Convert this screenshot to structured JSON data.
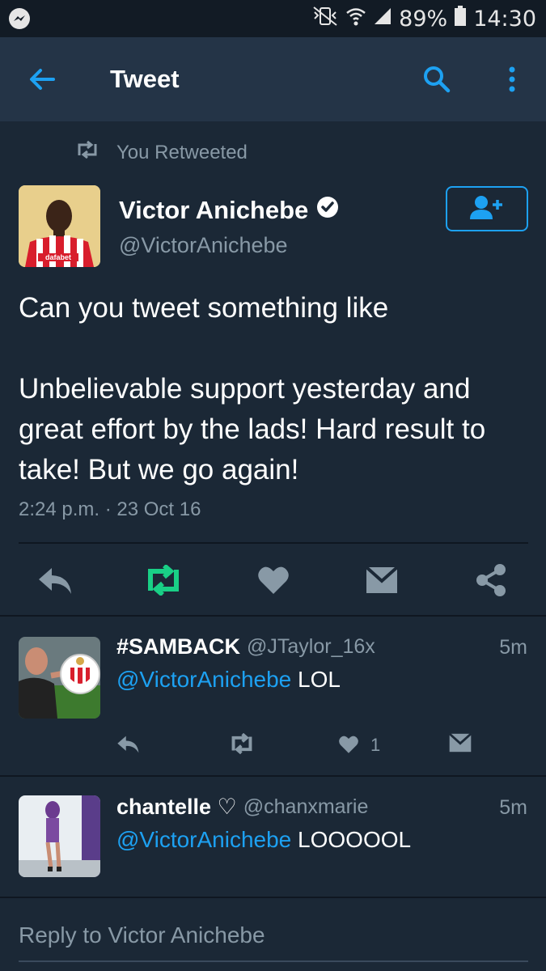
{
  "status_bar": {
    "battery": "89%",
    "time": "14:30"
  },
  "app_bar": {
    "title": "Tweet"
  },
  "retweet_notice": "You Retweeted",
  "tweet": {
    "author_name": "Victor Anichebe",
    "author_handle": "@VictorAnichebe",
    "text": "Can you tweet something like\n\nUnbelievable support yesterday and great effort by the lads! Hard result to take! But we go again!",
    "meta": "2:24 p.m. · 23 Oct 16",
    "avatar_shirt_text": "dafabet"
  },
  "replies": [
    {
      "name": "#SAMBACK",
      "handle": "@JTaylor_16x",
      "time": "5m",
      "mention": "@VictorAnichebe",
      "text": " LOL",
      "like_count": "1"
    },
    {
      "name": "chantelle ♡",
      "handle": "@chanxmarie",
      "time": "5m",
      "mention": "@VictorAnichebe",
      "text": " LOOOOOL"
    }
  ],
  "reply_prompt": "Reply to Victor Anichebe",
  "colors": {
    "accent": "#1da1f2",
    "retweet_green": "#19cf86",
    "background": "#1b2836",
    "appbar": "#243447"
  }
}
